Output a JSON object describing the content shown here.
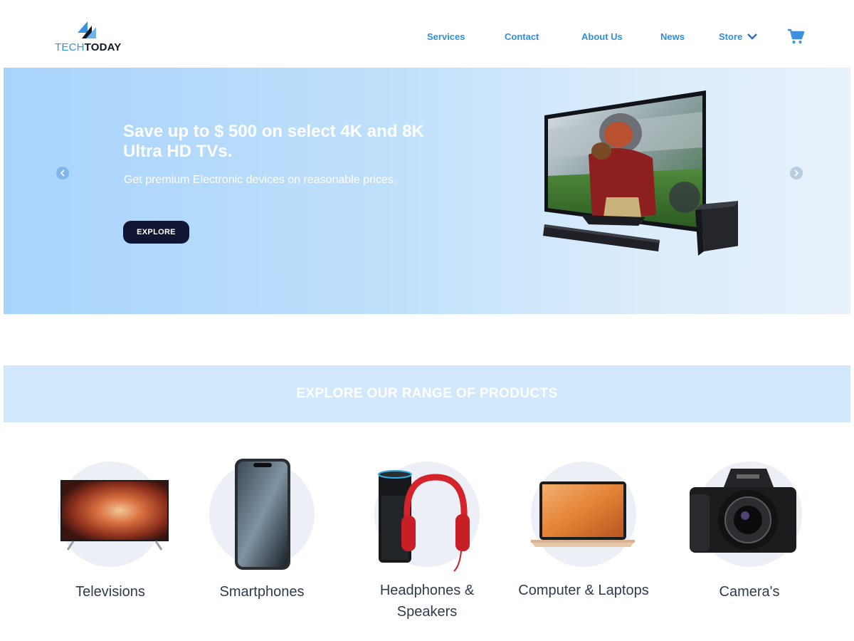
{
  "brand": {
    "part1": "TECH",
    "part2": "TODAY"
  },
  "nav": {
    "services": "Services",
    "contact": "Contact",
    "about": "About Us",
    "news": "News",
    "store": "Store"
  },
  "hero": {
    "title": "Save up to $ 500 on select 4K and 8K Ultra HD TVs.",
    "subtitle": "Get premium Electronic devices on reasonable prices.",
    "button": "EXPLORE"
  },
  "section": {
    "title": "EXPLORE OUR RANGE OF PRODUCTS"
  },
  "products": [
    {
      "label": "Televisions"
    },
    {
      "label": "Smartphones"
    },
    {
      "label": "Headphones & Speakers"
    },
    {
      "label": "Computer & Laptops"
    },
    {
      "label": "Camera's"
    }
  ],
  "icons": {
    "cart": "shopping-cart-icon",
    "store_dropdown": "chevron-down-icon",
    "prev": "chevron-left-icon",
    "next": "chevron-right-icon"
  },
  "colors": {
    "accent": "#2f8ee2",
    "hero_bg": "#a8d3fb",
    "button_dark": "#0f1533",
    "banner_bg": "#d2e8fd",
    "label_text": "#2e3b4e"
  }
}
